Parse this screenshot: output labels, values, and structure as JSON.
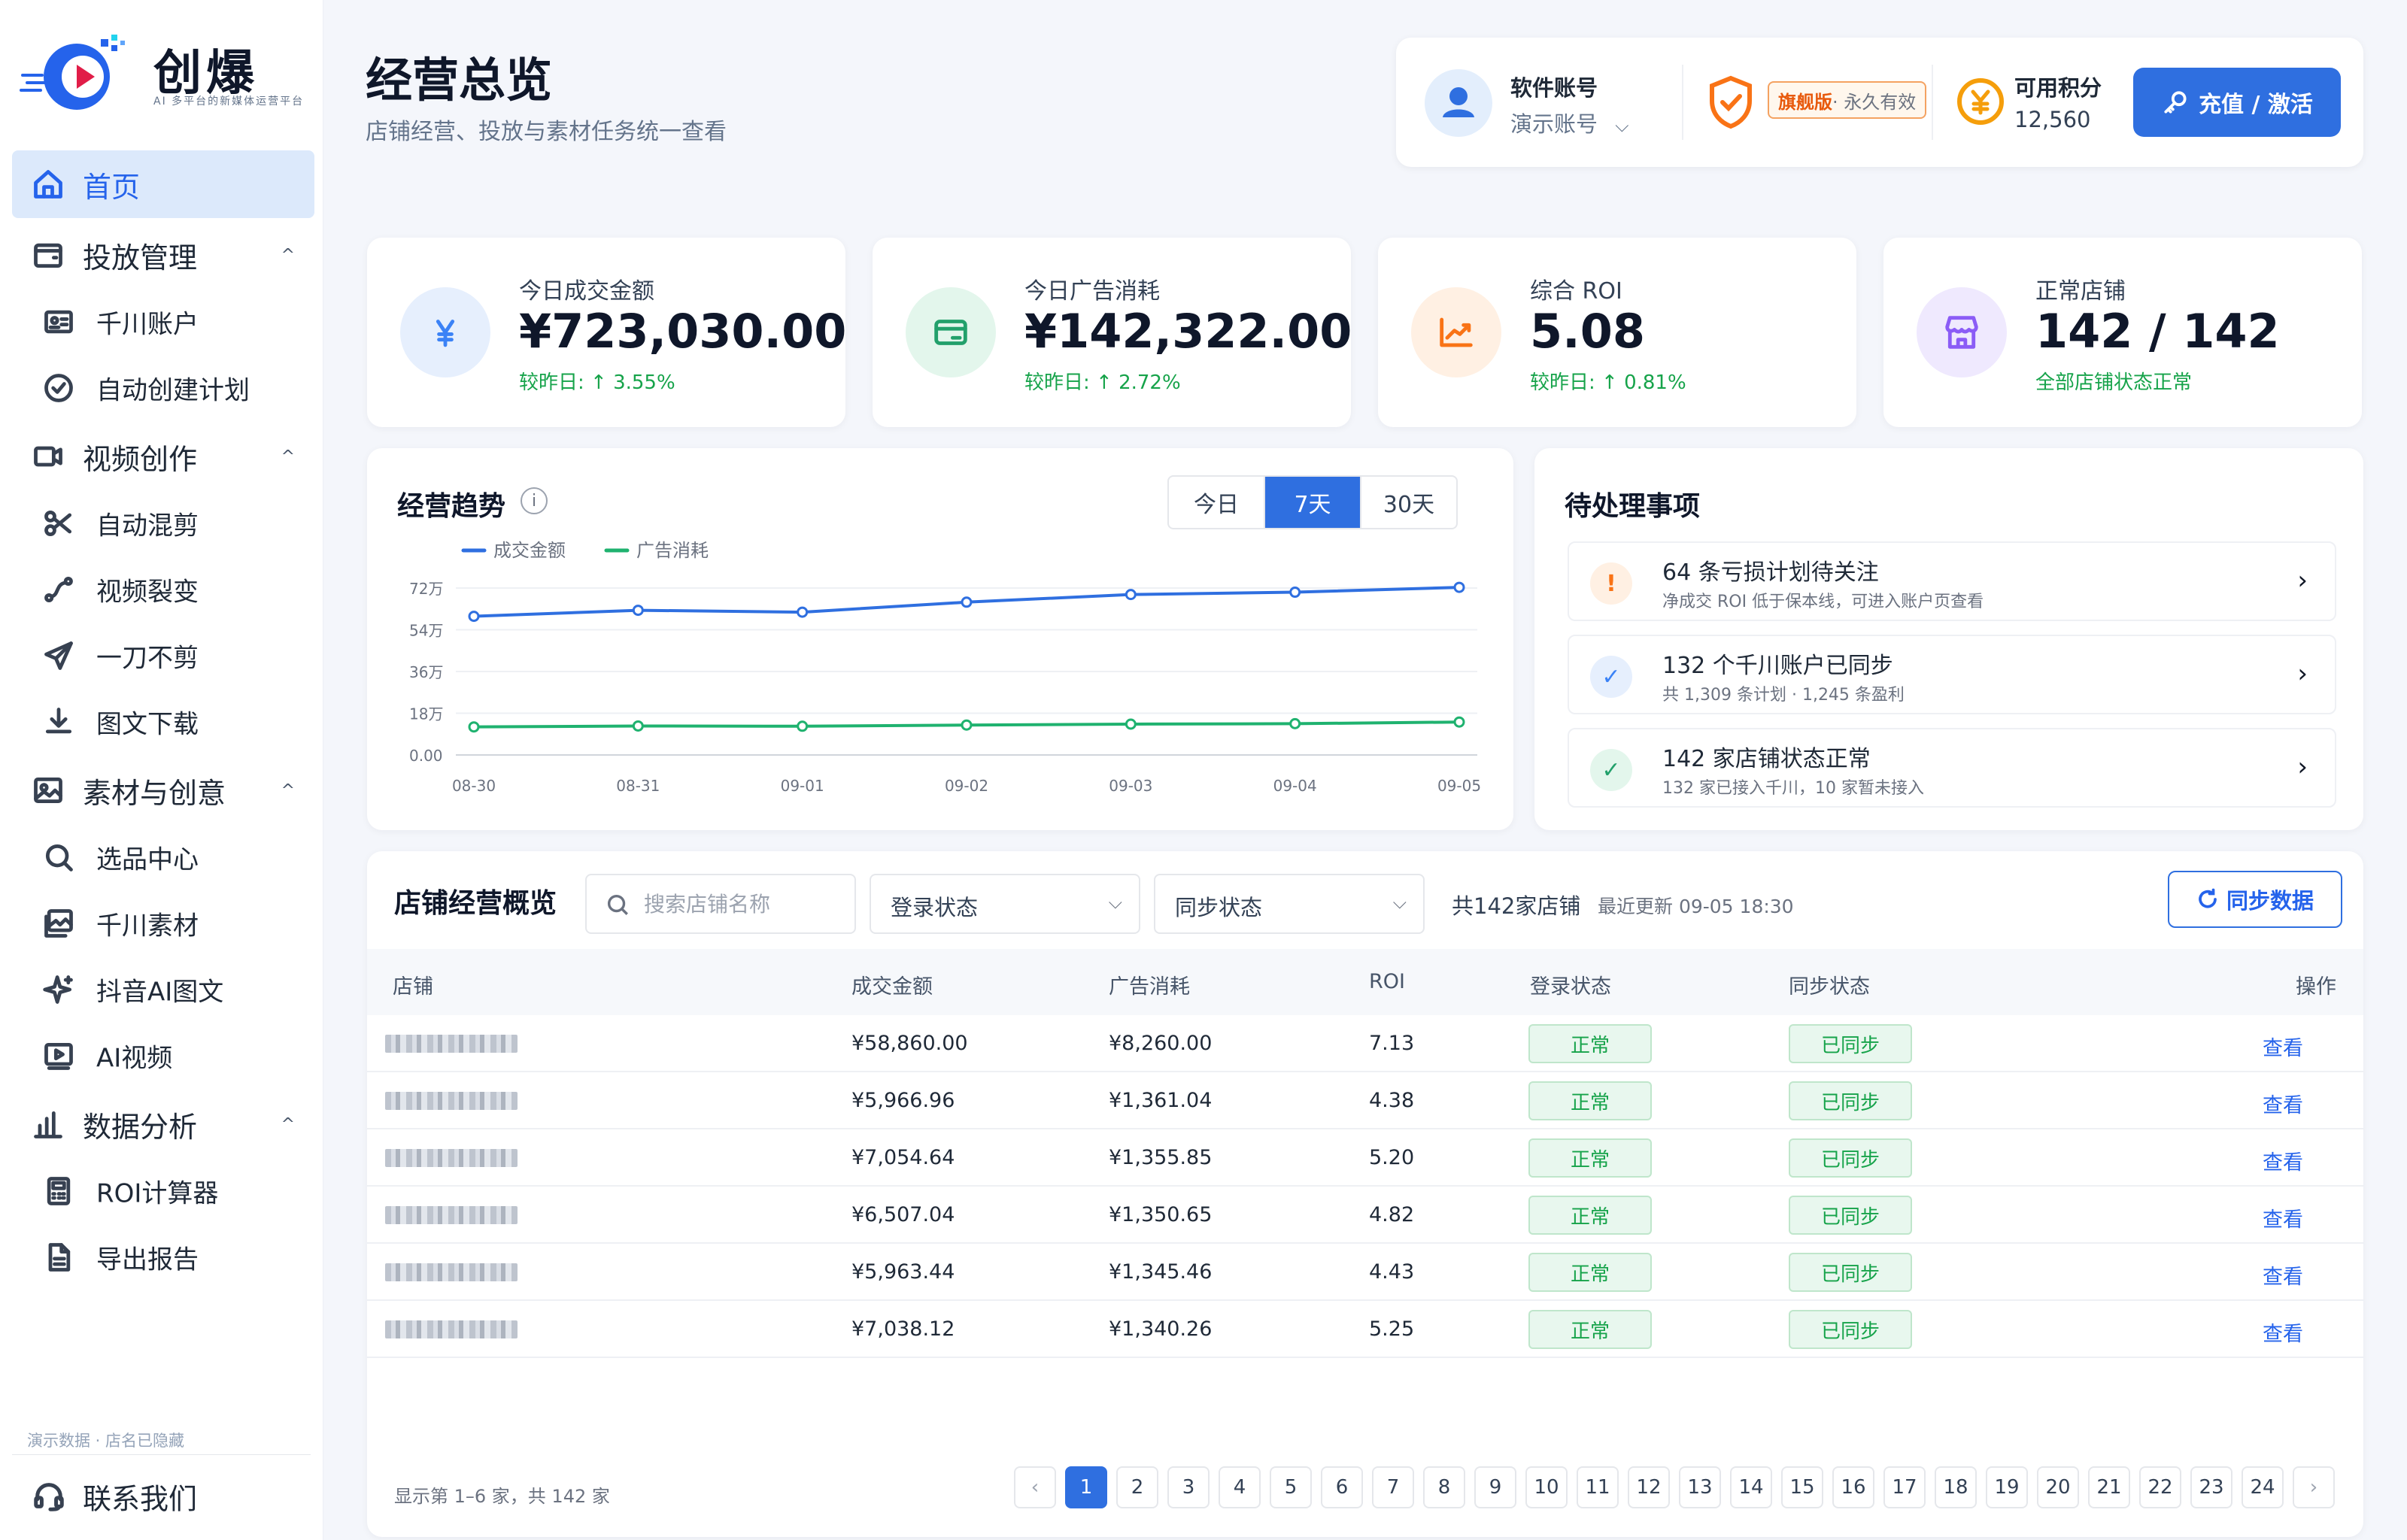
{
  "brand": {
    "name": "创爆",
    "tagline": "AI 多平台的新媒体运营平台"
  },
  "nav": {
    "home": "首页",
    "group_ads": "投放管理",
    "qianchuan_account": "千川账户",
    "auto_plan": "自动创建计划",
    "group_video": "视频创作",
    "auto_mix": "自动混剪",
    "video_fission": "视频裂变",
    "no_cut": "一刀不剪",
    "graphic_download": "图文下载",
    "group_material": "素材与创意",
    "selection_center": "选品中心",
    "qianchuan_material": "千川素材",
    "douyin_ai_graphic": "抖音AI图文",
    "ai_video": "AI视频",
    "group_data": "数据分析",
    "roi_calc": "ROI计算器",
    "export_report": "导出报告",
    "caret": "^",
    "demo_note": "演示数据 · 店名已隐藏",
    "contact": "联系我们"
  },
  "header": {
    "title": "经营总览",
    "subtitle": "店铺经营、投放与素材任务统一查看"
  },
  "account": {
    "label": "软件账号",
    "name": "演示账号",
    "chevron": "⌵",
    "edition": "旗舰版",
    "validity": "· 永久有效",
    "points_label": "可用积分",
    "points": "12,560",
    "recharge": "充值 / 激活"
  },
  "kpis": [
    {
      "label": "今日成交金额",
      "value": "¥723,030.00",
      "delta": "较昨日: ↑ 3.55%",
      "icon": "yen-icon",
      "color": "#3b82f6",
      "bg": "#e6effd"
    },
    {
      "label": "今日广告消耗",
      "value": "¥142,322.00",
      "delta": "较昨日: ↑ 2.72%",
      "icon": "card-icon",
      "color": "#22a06b",
      "bg": "#e3f6ec"
    },
    {
      "label": "综合 ROI",
      "value": "5.08",
      "delta": "较昨日: ↑ 0.81%",
      "icon": "trend-icon",
      "color": "#f97316",
      "bg": "#fff0e3"
    },
    {
      "label": "正常店铺",
      "value": "142 / 142",
      "delta": "全部店铺状态正常",
      "icon": "store-icon",
      "color": "#8b5cf6",
      "bg": "#efe9fe"
    }
  ],
  "trend": {
    "title": "经营趋势",
    "info": "i",
    "ranges": [
      "今日",
      "7天",
      "30天"
    ],
    "active_range": "7天"
  },
  "chart_data": {
    "type": "line",
    "x": [
      "08-30",
      "08-31",
      "09-01",
      "09-02",
      "09-03",
      "09-04",
      "09-05"
    ],
    "y_ticks": [
      "0.00",
      "18万",
      "36万",
      "54万",
      "72万"
    ],
    "ylim": [
      0,
      72
    ],
    "series": [
      {
        "name": "成交金额",
        "values": [
          59.8,
          62.4,
          61.6,
          65.9,
          69.2,
          70.2,
          72.3
        ],
        "color": "#2f6fe0"
      },
      {
        "name": "广告消耗",
        "values": [
          12.1,
          12.5,
          12.4,
          12.9,
          13.3,
          13.5,
          14.2
        ],
        "color": "#1fb26f"
      }
    ],
    "grid": true,
    "legend": "top-left"
  },
  "todo": {
    "title": "待处理事项",
    "items": [
      {
        "icon": "!",
        "title": "64 条亏损计划待关注",
        "sub": "净成交 ROI 低于保本线，可进入账户页查看",
        "color": "#f97316",
        "bg": "#fff0e3"
      },
      {
        "icon": "✓",
        "title": "132 个千川账户已同步",
        "sub": "共 1,309 条计划 · 1,245 条盈利",
        "color": "#3b82f6",
        "bg": "#e6effd"
      },
      {
        "icon": "✓",
        "title": "142 家店铺状态正常",
        "sub": "132 家已接入千川，10 家暂未接入",
        "color": "#22a06b",
        "bg": "#e3f6ec"
      }
    ],
    "arrow": "›"
  },
  "stores": {
    "title": "店铺经营概览",
    "search_placeholder": "搜索店铺名称",
    "login_filter": "登录状态",
    "sync_filter": "同步状态",
    "chevron": "⌵",
    "count": "共142家店铺",
    "updated": "最近更新 09-05 18:30",
    "sync_button": "同步数据",
    "columns": [
      "店铺",
      "成交金额",
      "广告消耗",
      "ROI",
      "登录状态",
      "同步状态",
      "操作"
    ],
    "rows": [
      {
        "sales": "¥58,860.00",
        "cost": "¥8,260.00",
        "roi": "7.13",
        "login": "正常",
        "sync": "已同步",
        "action": "查看"
      },
      {
        "sales": "¥5,966.96",
        "cost": "¥1,361.04",
        "roi": "4.38",
        "login": "正常",
        "sync": "已同步",
        "action": "查看"
      },
      {
        "sales": "¥7,054.64",
        "cost": "¥1,355.85",
        "roi": "5.20",
        "login": "正常",
        "sync": "已同步",
        "action": "查看"
      },
      {
        "sales": "¥6,507.04",
        "cost": "¥1,350.65",
        "roi": "4.82",
        "login": "正常",
        "sync": "已同步",
        "action": "查看"
      },
      {
        "sales": "¥5,963.44",
        "cost": "¥1,345.46",
        "roi": "4.43",
        "login": "正常",
        "sync": "已同步",
        "action": "查看"
      },
      {
        "sales": "¥7,038.12",
        "cost": "¥1,340.26",
        "roi": "5.25",
        "login": "正常",
        "sync": "已同步",
        "action": "查看"
      }
    ],
    "pagination": {
      "info": "显示第 1–6 家，共 142 家",
      "prev": "‹",
      "next": "›",
      "current": "1",
      "pages": [
        "1",
        "2",
        "3",
        "4",
        "5",
        "6",
        "7",
        "8",
        "9",
        "10",
        "11",
        "12",
        "13",
        "14",
        "15",
        "16",
        "17",
        "18",
        "19",
        "20",
        "21",
        "22",
        "23",
        "24"
      ]
    }
  }
}
